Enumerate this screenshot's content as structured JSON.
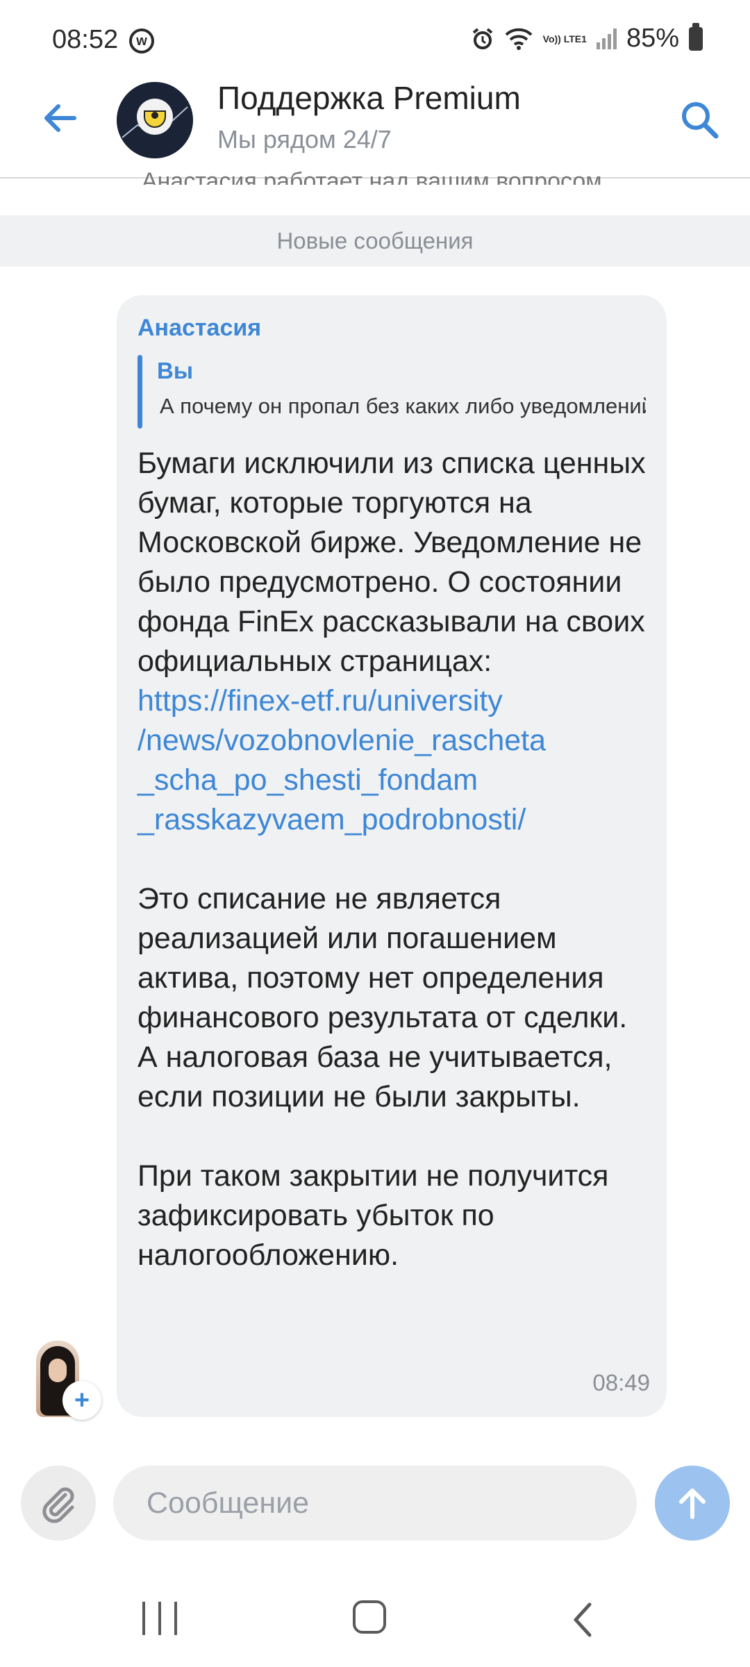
{
  "status_bar": {
    "time": "08:52",
    "app_badge": "w",
    "battery_pct": "85%",
    "volte": "Vo)) LTE1"
  },
  "header": {
    "title": "Поддержка Premium",
    "subtitle": "Мы рядом 24/7",
    "icons": [
      "back-arrow-icon",
      "search-icon"
    ]
  },
  "cut_system_text": "Анастасия работает над вашим вопросом.",
  "new_messages_label": "Новые сообщения",
  "message": {
    "sender": "Анастасия",
    "quote_author": "Вы",
    "quote_text": "А почему он пропал без каких либо уведомлений",
    "paragraph1": "Бумаги исключили из списка ценных бумаг, которые торгуются на Московской бирже. Уведомление не было предусмотрено. О состоянии фонда FinEx рассказывали на своих официальных страницах:",
    "link_lines": [
      "https://finex-etf.ru/university",
      "/news/vozobnovlenie_rascheta",
      "_scha_po_shesti_fondam",
      "_rasskazyvaem_podrobnosti/"
    ],
    "paragraph2": "Это списание не является реализацией или погашением актива, поэтому нет определения финансового результата от сделки. А налоговая база не учитывается, если позиции не были закрыты.",
    "paragraph3": "При таком закрытии не получится зафиксировать убыток по налогообложению.",
    "time": "08:49"
  },
  "composer": {
    "placeholder": "Сообщение",
    "icons": [
      "paperclip-icon",
      "send-arrow-icon"
    ]
  },
  "colors": {
    "accent": "#3d87d6",
    "bubble": "#f0f1f2",
    "send_button": "#9cc3f0"
  }
}
